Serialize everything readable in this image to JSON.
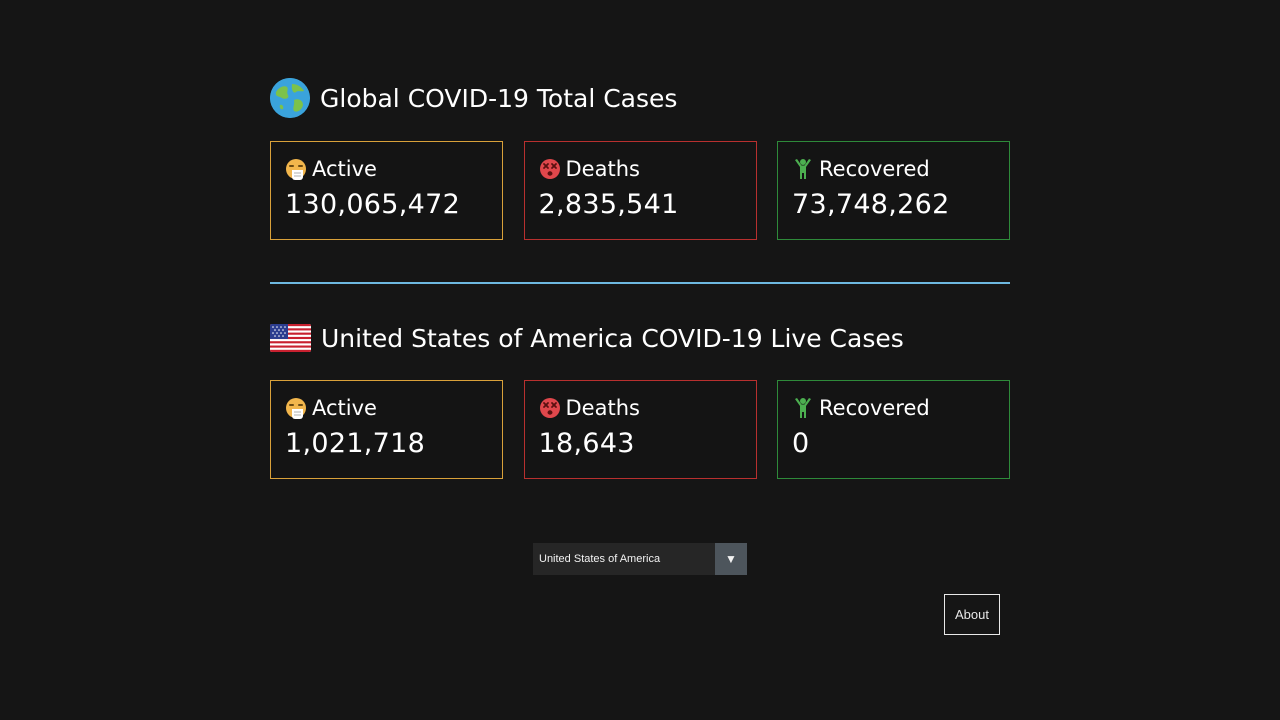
{
  "global": {
    "title": "Global COVID-19 Total Cases",
    "icon": "globe-icon",
    "active_label": "Active",
    "active_value": "130,065,472",
    "deaths_label": "Deaths",
    "deaths_value": "2,835,541",
    "recovered_label": "Recovered",
    "recovered_value": "73,748,262"
  },
  "country": {
    "title": "United States of America COVID-19 Live Cases",
    "icon": "us-flag-icon",
    "active_label": "Active",
    "active_value": "1,021,718",
    "deaths_label": "Deaths",
    "deaths_value": "18,643",
    "recovered_label": "Recovered",
    "recovered_value": "0"
  },
  "country_select": {
    "selected": "United States of America"
  },
  "about_button": {
    "label": "About"
  },
  "colors": {
    "background": "#151515",
    "active": "#d9a13a",
    "deaths": "#b8302f",
    "recovered": "#2e8a3a",
    "divider": "#6db8e0"
  }
}
